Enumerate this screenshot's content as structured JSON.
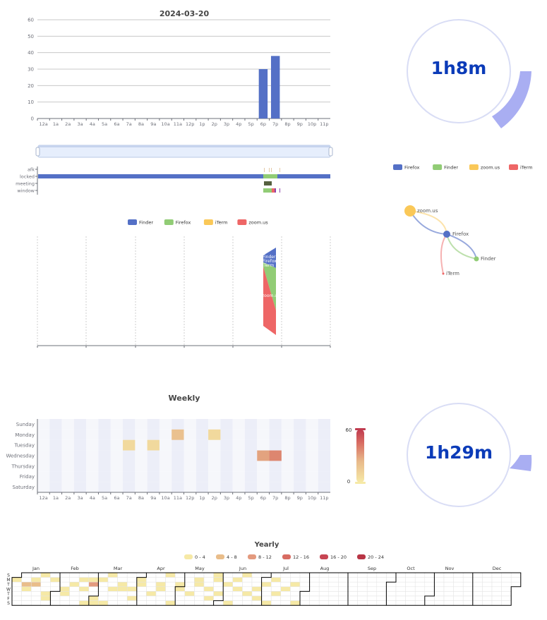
{
  "colors": {
    "finder": "#5470c6",
    "firefox": "#91cc75",
    "zoom": "#fac858",
    "iterm": "#ee6666",
    "meeting": "#55603f",
    "gauge": "#a9aef2",
    "gauge_text": "#0b3bb8",
    "heat_scale": [
      "#f6e9a6",
      "#e9bd8a",
      "#e39a7e",
      "#d86c62",
      "#c74553",
      "#b83545"
    ]
  },
  "hours": [
    "12a",
    "1a",
    "2a",
    "3a",
    "4a",
    "5a",
    "6a",
    "7a",
    "8a",
    "9a",
    "10a",
    "11a",
    "12p",
    "1p",
    "2p",
    "3p",
    "4p",
    "5p",
    "6p",
    "7p",
    "8p",
    "9p",
    "10p",
    "11p"
  ],
  "daily": {
    "gauge_label": "1h8m",
    "chart_data": {
      "type": "bar",
      "title": "2024-03-20",
      "categories": [
        "12a",
        "1a",
        "2a",
        "3a",
        "4a",
        "5a",
        "6a",
        "7a",
        "8a",
        "9a",
        "10a",
        "11a",
        "12p",
        "1p",
        "2p",
        "3p",
        "4p",
        "5p",
        "6p",
        "7p",
        "8p",
        "9p",
        "10p",
        "11p"
      ],
      "values": [
        0,
        0,
        0,
        0,
        0,
        0,
        0,
        0,
        0,
        0,
        0,
        0,
        0,
        0,
        0,
        0,
        0,
        0,
        30,
        38,
        0,
        0,
        0,
        0
      ],
      "ylim": [
        0,
        60
      ],
      "yticks": [
        0,
        10,
        20,
        30,
        40,
        50,
        60
      ],
      "grid": true
    }
  },
  "timeline": {
    "rows": [
      "afk",
      "locked",
      "meeting",
      "window"
    ],
    "legend": [
      "Firefox",
      "Finder",
      "zoom.us",
      "iTerm"
    ]
  },
  "flow": {
    "legend": [
      "Finder",
      "Firefox",
      "iTerm",
      "zoom.us"
    ],
    "stream_labels": [
      "Finder",
      "Firefox",
      "iTerm",
      "zoom.us"
    ]
  },
  "graph": {
    "nodes": [
      "zoom.us",
      "Firefox",
      "Finder",
      "iTerm"
    ]
  },
  "weekly": {
    "gauge_label": "1h29m",
    "chart_data": {
      "type": "heatmap",
      "title": "Weekly",
      "rows": [
        "Sunday",
        "Monday",
        "Tuesday",
        "Wednesday",
        "Thursday",
        "Friday",
        "Saturday"
      ],
      "cells": [
        {
          "day": "Monday",
          "hour": "11a",
          "value": 20
        },
        {
          "day": "Monday",
          "hour": "2p",
          "value": 8
        },
        {
          "day": "Tuesday",
          "hour": "7a",
          "value": 8
        },
        {
          "day": "Tuesday",
          "hour": "9a",
          "value": 8
        },
        {
          "day": "Wednesday",
          "hour": "6p",
          "value": 30
        },
        {
          "day": "Wednesday",
          "hour": "7p",
          "value": 38
        }
      ],
      "visual_map": {
        "min": 0,
        "max": 60,
        "min_label": "0",
        "max_label": "60"
      }
    }
  },
  "yearly": {
    "title": "Yearly",
    "legend": [
      "0 - 4",
      "4 - 8",
      "8 - 12",
      "12 - 16",
      "16 - 20",
      "20 - 24"
    ],
    "months": [
      "Jan",
      "Feb",
      "Mar",
      "Apr",
      "May",
      "Jun",
      "Jul",
      "Aug",
      "Sep",
      "Oct",
      "Nov",
      "Dec"
    ],
    "day_labels": [
      "S",
      "M",
      "T",
      "W",
      "T",
      "F",
      "S"
    ]
  }
}
